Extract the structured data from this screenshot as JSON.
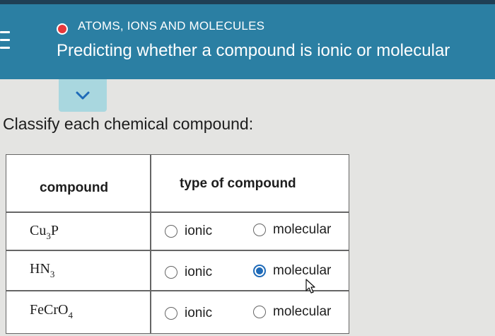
{
  "header": {
    "topic": "ATOMS, IONS AND MOLECULES",
    "title": "Predicting whether a compound is ionic or molecular",
    "topic_dot_color": "#e8383b",
    "background_color": "#2b7fa3"
  },
  "collapse_button": {
    "icon": "chevron-down-icon"
  },
  "instruction": "Classify each chemical compound:",
  "table": {
    "headers": [
      "compound",
      "type of compound"
    ],
    "rows": [
      {
        "formula_parts": [
          "Cu",
          "3",
          "P"
        ],
        "options": [
          "ionic",
          "molecular"
        ],
        "selected": null
      },
      {
        "formula_parts": [
          "HN",
          "3",
          ""
        ],
        "options": [
          "ionic",
          "molecular"
        ],
        "selected": "molecular"
      },
      {
        "formula_parts": [
          "FeCrO",
          "4",
          ""
        ],
        "options": [
          "ionic",
          "molecular"
        ],
        "selected": null
      }
    ]
  }
}
